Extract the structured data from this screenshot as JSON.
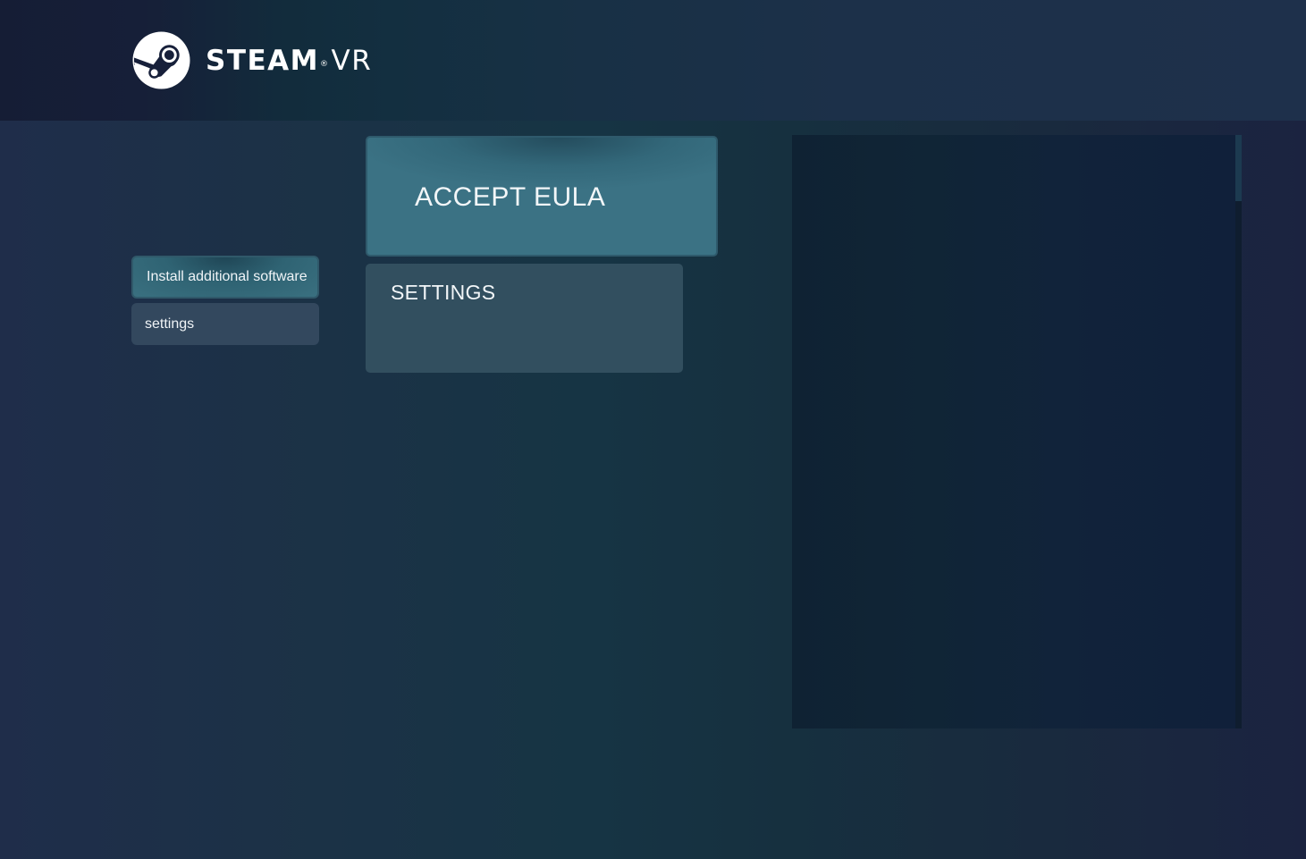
{
  "header": {
    "logo": {
      "brand": "STEAM",
      "registered": "®",
      "product": "VR",
      "icon": "steam-logo-icon"
    }
  },
  "sidebar": {
    "items": [
      {
        "label": "Install additional software",
        "active": true
      },
      {
        "label": "settings",
        "active": false
      }
    ]
  },
  "main": {
    "tiles": [
      {
        "label": "ACCEPT EULA",
        "highlighted": true
      },
      {
        "label": "SETTINGS",
        "highlighted": false
      }
    ]
  },
  "content_panel": {
    "scroll_position": 0,
    "empty": true
  },
  "colors": {
    "accent": "#3a7080",
    "panel": "#10233a",
    "text": "#ffffff"
  }
}
